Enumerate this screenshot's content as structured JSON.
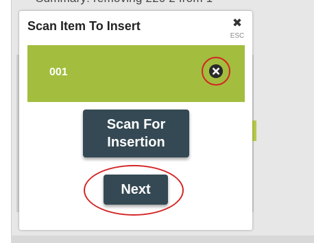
{
  "background": {
    "summary_text": "Summary: removing 220 2 from 1"
  },
  "modal": {
    "title": "Scan Item To Insert",
    "close": {
      "icon": "close-icon",
      "glyph": "✖",
      "hint": "ESC"
    },
    "item": {
      "label": "001",
      "remove_icon": "remove-circle-x-icon"
    },
    "scan_button_label": "Scan For\nInsertion",
    "next_button_label": "Next"
  },
  "colors": {
    "item_row_bg": "#a3bd3e",
    "button_bg": "#344953",
    "highlight_ring": "#d42424"
  }
}
